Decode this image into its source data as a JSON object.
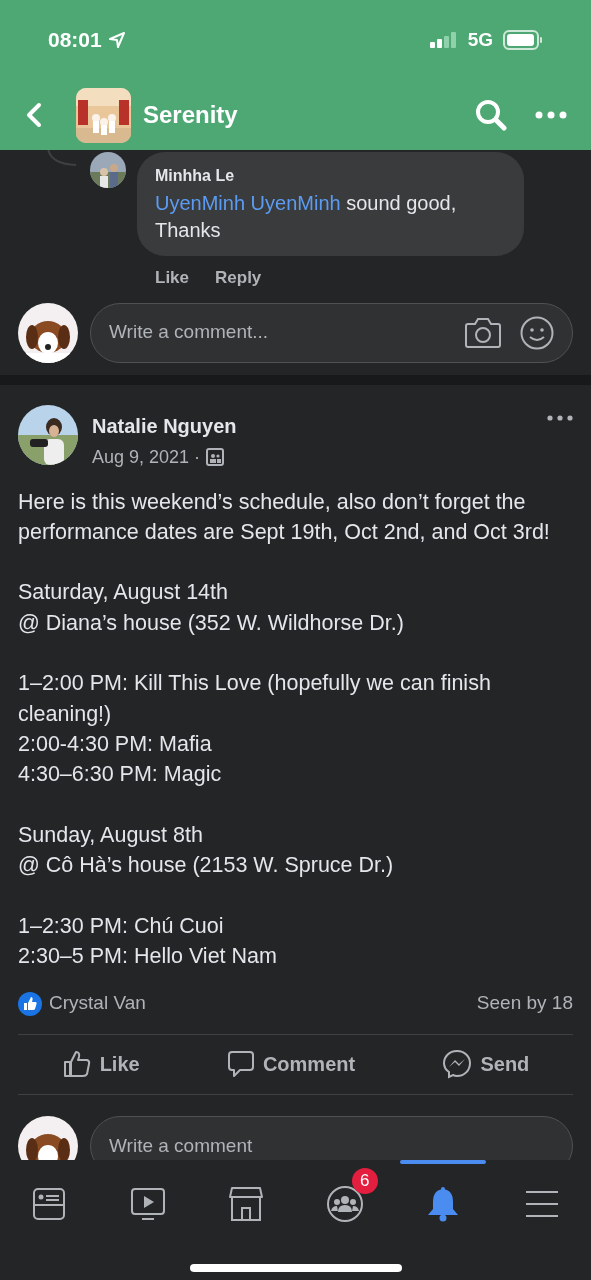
{
  "status_bar": {
    "time": "08:01",
    "network": "5G"
  },
  "header": {
    "title": "Serenity"
  },
  "reply": {
    "author": "Minhha Le",
    "text": "sound good, Thanks",
    "mention": "UyenMinh UyenMinh",
    "actions": [
      "Like",
      "Reply"
    ]
  },
  "comment_box": {
    "placeholder": "Write a comment..."
  },
  "post": {
    "author": "Natalie Nguyen",
    "date": "Aug 9, 2021 ·",
    "paragraphs": [
      [
        "Here is this weekend’s schedule, also don’t forget the performance dates are Sept 19th, Oct 2nd, and Oct 3rd!"
      ],
      [
        "Saturday, August 14th",
        "@ Diana’s house (352 W. Wildhorse Dr.)"
      ],
      [
        "1–2:00 PM: Kill This Love (hopefully we can finish cleaning!)",
        "2:00-4:30 PM: Mafia",
        "4:30–6:30 PM: Magic"
      ],
      [
        "Sunday, August 8th",
        "@ Cô Hà’s house (2153 W. Spruce Dr.)"
      ],
      [
        "1–2:30 PM: Chú Cuoi",
        "2:30–5 PM: Hello Viet Nam"
      ]
    ],
    "liked_by": "Crystal Van",
    "seen": "Seen by 18",
    "actions": [
      {
        "kind": "like",
        "label": "Like"
      },
      {
        "kind": "comment",
        "label": "Comment"
      },
      {
        "kind": "send",
        "label": "Send"
      }
    ]
  },
  "comment_box_2": {
    "placeholder": "Write a comment"
  },
  "tabs": [
    {
      "kind": "feed",
      "selected": false
    },
    {
      "kind": "watch",
      "selected": false
    },
    {
      "kind": "marketplace",
      "selected": false
    },
    {
      "kind": "groups",
      "selected": false,
      "badge": "6"
    },
    {
      "kind": "notifications",
      "selected": true
    },
    {
      "kind": "menu",
      "selected": false
    }
  ]
}
